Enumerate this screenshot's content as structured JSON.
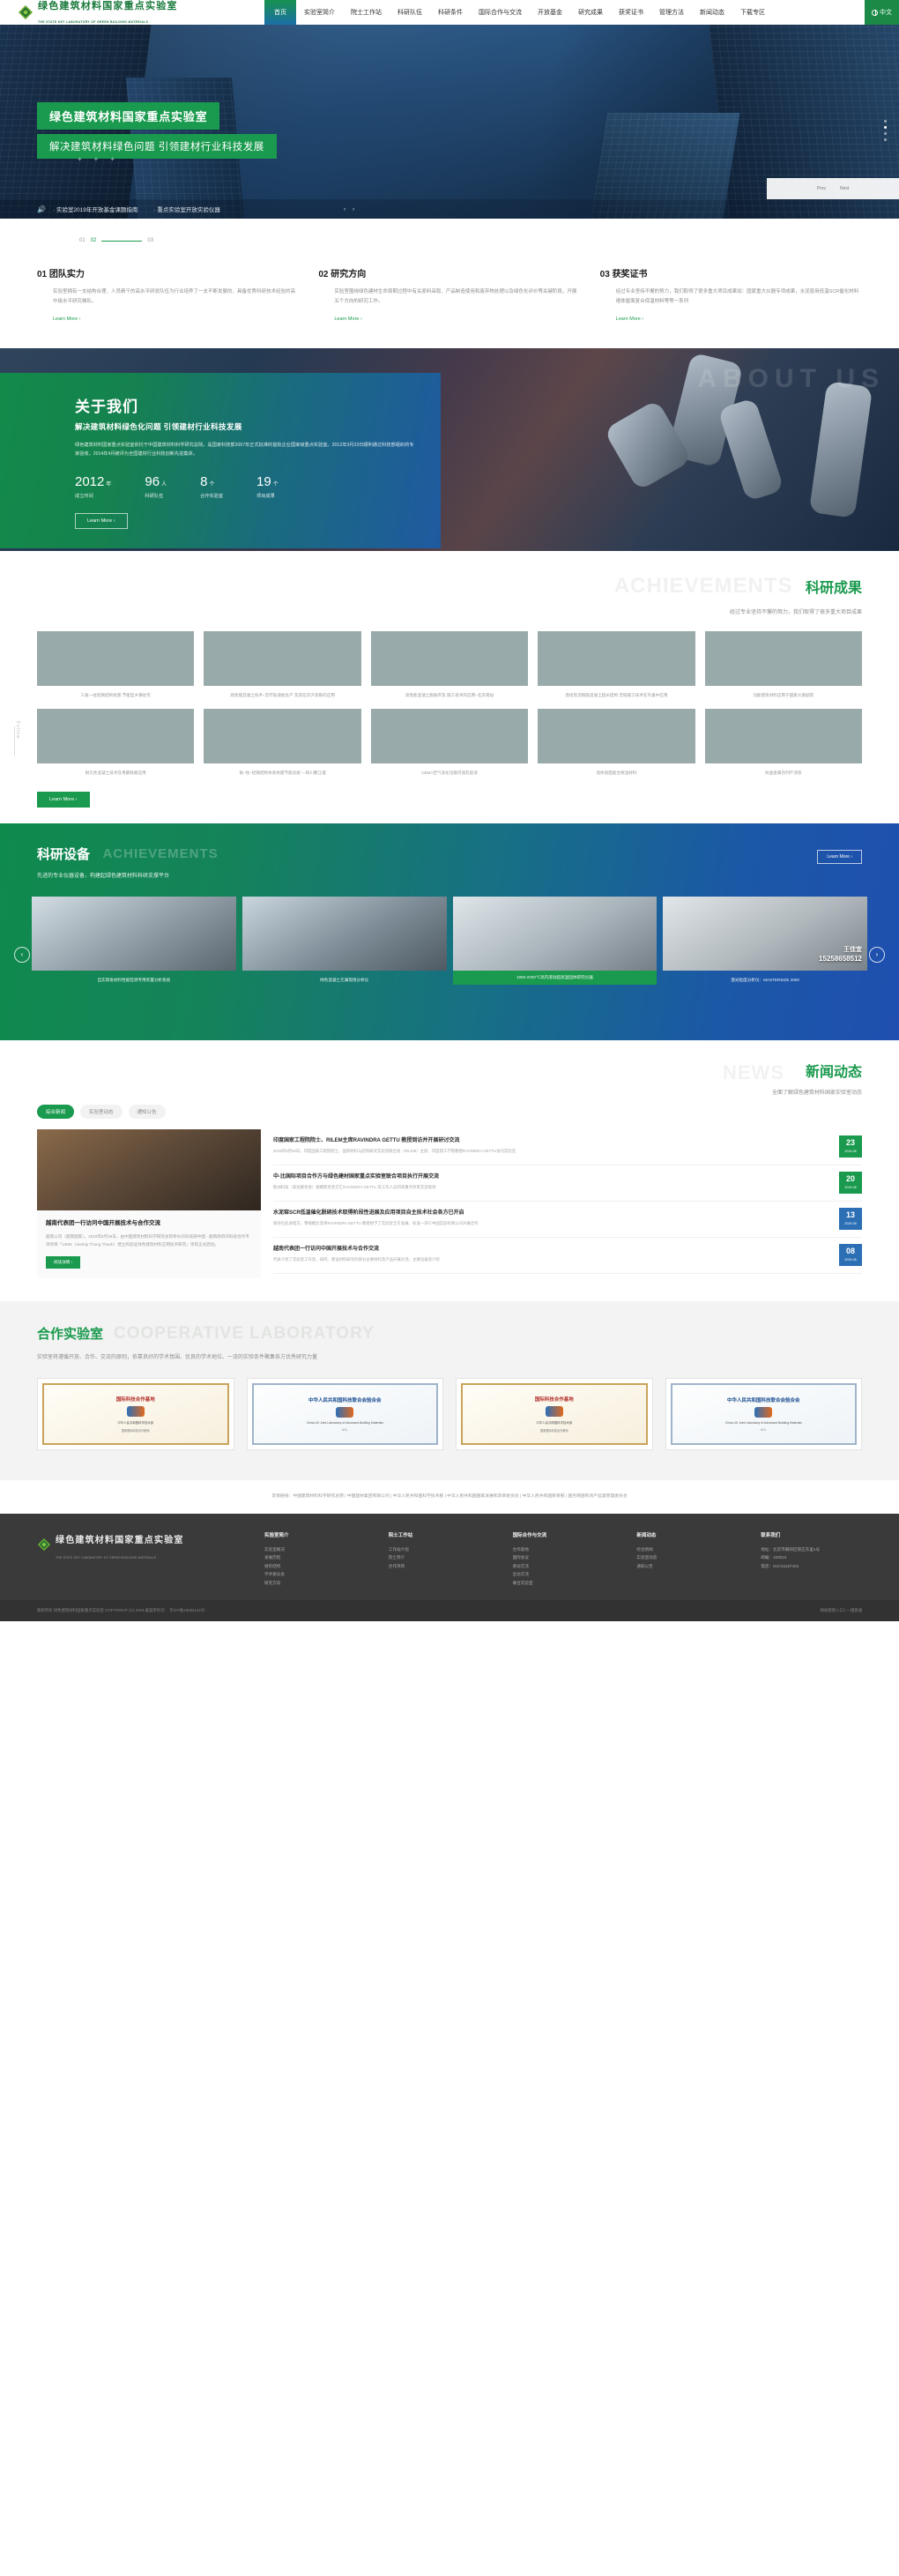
{
  "site": {
    "logo_cn": "绿色建筑材料国家重点实验室",
    "logo_en": "THE STATE KEY LABORATORY OF GREEN BUILDING MATERIALS"
  },
  "nav": {
    "home": "首页",
    "items": [
      "实验室简介",
      "院士工作站",
      "科研队伍",
      "科研条件",
      "国际合作与交流",
      "开放基金",
      "研究成果",
      "获奖证书",
      "管理方法",
      "新闻动态",
      "下载专区"
    ],
    "lang": "中文"
  },
  "hero": {
    "title": "绿色建筑材料国家重点实验室",
    "subtitle": "解决建筑材料绿色问题 引领建材行业科技发展",
    "notice_1": "· 实验室2019年开放基金课题指南",
    "notice_2": "· 重点实验室开放实验仪器",
    "side_prev": "Prev",
    "side_next": "Next"
  },
  "steps": {
    "s1": "01",
    "s2": "02",
    "s3": "03"
  },
  "intro": {
    "columns": [
      {
        "num": "01",
        "title": "团队实力",
        "text": "实验室拥有一支结构合理、人员精干的高水平研发队伍为行业培养了一支不断发展的、具备优秀科研技术经验的高中级水平研究梯队。",
        "link": "Learn More ›"
      },
      {
        "num": "02",
        "title": "研究方向",
        "text": "实验室围绕绿色建材生命周期过程中有关原料采取、产品制造使用和废弃物处理以及绿色化评价等关键阶段，开展五个方向的研究工作。",
        "link": "Learn More ›"
      },
      {
        "num": "03",
        "title": "获奖证书",
        "text": "经过专业坚持不懈的努力，我们取得了很多重大项目成果如：国家重大仪器专项成果，水泥窑用低温SCR催化材料墙体屋面复合保温材料等等一系列",
        "link": "Learn More ›"
      }
    ]
  },
  "about": {
    "watermark": "ABOUT US",
    "title": "关于我们",
    "subtitle": "解决建筑材料绿色化问题 引领建材行业科技发展",
    "text": "绿色建筑材料国家重点实验室依托于中国建筑材料科学研究总院，是国家科技部2007年正式批准的首批企业国家级重点实验室。2012年3月23日顺利通过科技部组织的专家验收，2014年4月被评为全国建材行业科技创新先进集体。",
    "stats": [
      {
        "num": "2012",
        "unit": "年",
        "label": "成立时间"
      },
      {
        "num": "96",
        "unit": "人",
        "label": "科研队伍"
      },
      {
        "num": "8",
        "unit": "个",
        "label": "合作实验室"
      },
      {
        "num": "19",
        "unit": "个",
        "label": "项目成果"
      }
    ],
    "button": "Learn More ›"
  },
  "achievements": {
    "watermark": "ACHIEVEMENTS",
    "title": "科研成果",
    "subtitle": "经过专业坚持不懈的努力，我们取得了很多重大项目成果",
    "follow": "Follow",
    "items": [
      "三板一柱轻钢结构抗震\n节能型乡镇住宅",
      "高性能混凝土技术–无咋轨道板生产\n及其在京沪高铁的应用",
      "高性能混凝土膨胀剂及\n施工技术的应用–北京南站",
      "连续现浇钢筋混凝土超长结构\n无缝施工技术在鸟巢中应用",
      "功能建筑材料应用于国家大歌剧院",
      "耐久性混凝土技术在青藏铁路应用",
      "板–柱–轻钢结构体系抗震节能房屋\n—四川都江堰",
      "CBMA空气净化功能内墙乳胶漆",
      "墙体屋面复合保温材料",
      "防盗金属热列产消等"
    ],
    "button": "Learn More ›"
  },
  "equipment": {
    "title": "科研设备",
    "watermark": "ACHIEVEMENTS",
    "subtitle": "先进的专业仪器设备，构建起绿色建筑材料科研支撑平台",
    "more": "Learn More ›",
    "items": [
      {
        "caption": "自实研发材料性能检测专用装置分析系统",
        "selected": false
      },
      {
        "caption": "绿色混凝土元满现场分析仪",
        "selected": false
      },
      {
        "caption": "1900-2000℃高内液动超高温固体研究仪器",
        "selected": true
      },
      {
        "caption": "激光粒度分析仪：MASTERSIZE 2000",
        "selected": false
      }
    ],
    "overlay_name": "王佳宜",
    "overlay_phone": "15258658512"
  },
  "news": {
    "watermark": "NEWS",
    "title": "新闻动态",
    "subtitle": "全面了解绿色建筑材料国家实验室动态",
    "tabs": [
      "综合新闻",
      "实验室动态",
      "通知公告"
    ],
    "feature": {
      "title": "越南代表团一行访问中国开展技术与合作交流",
      "desc": "越南公司（越南国家），2019年8月28日，由中国建筑材料科学研究总院牵头的科技部中国 - 越南政府间科技合作专项项目「VBIM（Vietnip Thong Thanh）建立和验证绿色建筑材料应用技术研究」项目正式启动。",
      "button": "阅读详情 ›"
    },
    "items": [
      {
        "title": "印度国家工程院院士、RILEM主席RAVINDRA GETTU 教授到访并开展研讨交流",
        "desc": "2019年8月20日，印度国家工程院院士、国际材料与结构研究实验室联合会（RILEM）主席、印度理工学院教授RAVINDRA GETTU访问实验室",
        "day": "23",
        "month": "2019-08",
        "alt": false
      },
      {
        "title": "中-比国际项目合作方与绿色建材国家重点实验室联合项目执行开展交流",
        "desc": "欧洲科技（安加基金会）规模新资金交汇RAVINDRA GETTU 及工作人员到来重点项目交流现场",
        "day": "20",
        "month": "2019-08",
        "alt": false
      },
      {
        "title": "水泥窑SCR低温催化脱硝技术取得阶段性进展及应用项目自主技术社会各方已开启",
        "desc": "保持在此承担方，零规模企及用RAVINDRA GETTU 教授授予了实验室全方发展，标准一日行中国实验有限公司开展合作",
        "day": "13",
        "month": "2019-08",
        "alt": true
      },
      {
        "title": "越南代表团一行访问中国开展技术与合作交流",
        "desc": "代表介绍了实验室工作室、研究、建设材料研究的部分主要材料及产品开展对话，主要设备及介绍",
        "day": "08",
        "month": "2019-08",
        "alt": true
      }
    ]
  },
  "cooperation": {
    "title_cn": "合作实验室",
    "title_en": "COOPERATIVE LABORATORY",
    "subtitle": "实验室将遵循开放、合作、交流的原则，依靠良好的学术氛围、优良的学术地位、一流的实验条件聚集各方优秀研究力量",
    "certs": [
      {
        "l1": "国际科技合作基地",
        "l2": "中华人民共和国科学技术部",
        "l3": "国家国际科技合作基地",
        "style": "gold"
      },
      {
        "l1": "中华人民共和国科技联合会验合会",
        "l2": "China UK Joint Laboratory of Advanced Building Materials",
        "l3": "UCL",
        "style": "blue"
      },
      {
        "l1": "国际科技合作基地",
        "l2": "中华人民共和国科学技术部",
        "l3": "国家国际科技合作基地",
        "style": "gold"
      },
      {
        "l1": "中华人民共和国科技联合会验合会",
        "l2": "China UK Joint Laboratory of Advanced Building Materials",
        "l3": "UCL",
        "style": "blue"
      }
    ]
  },
  "links": {
    "text": "友情链接：中国建筑材料科学研究总院 | 中国建材集团有限公司 | 中华人民共和国科学技术部 | 中华人民共和国国家发展和改革委员会 | 中华人民共和国教育部 | 国务院国有资产监督管理委员会"
  },
  "footer": {
    "logo_cn": "绿色建筑材料国家重点实验室",
    "logo_en": "THE STATE KEY LABORATORY OF GREEN BUILDING MATERIALS",
    "cols": [
      {
        "title": "实验室简介",
        "links": [
          "实验室概况",
          "发展历程",
          "组织结构",
          "学术委员会",
          "研究方向"
        ]
      },
      {
        "title": "院士工作站",
        "links": [
          "工作站介绍",
          "院士简介",
          "合作项目"
        ]
      },
      {
        "title": "国际合作与交流",
        "links": [
          "合作基地",
          "国际会议",
          "来访交流",
          "出访交流",
          "联合实验室"
        ]
      },
      {
        "title": "新闻动态",
        "links": [
          "综合新闻",
          "实验室动态",
          "通知公告"
        ]
      },
      {
        "title": "联系我们",
        "contact": [
          "地址：北京市朝阳区管庄东里1号",
          "邮编：100024",
          "电话：010-51167404"
        ]
      }
    ]
  },
  "copyright": {
    "left": "版权所有 绿色建筑材料国家重点实验室  COPYRIGHT (C) 2019 备案序列号： 京ICP备15052122号-",
    "right": "网站管理入口 | 一键直通"
  }
}
